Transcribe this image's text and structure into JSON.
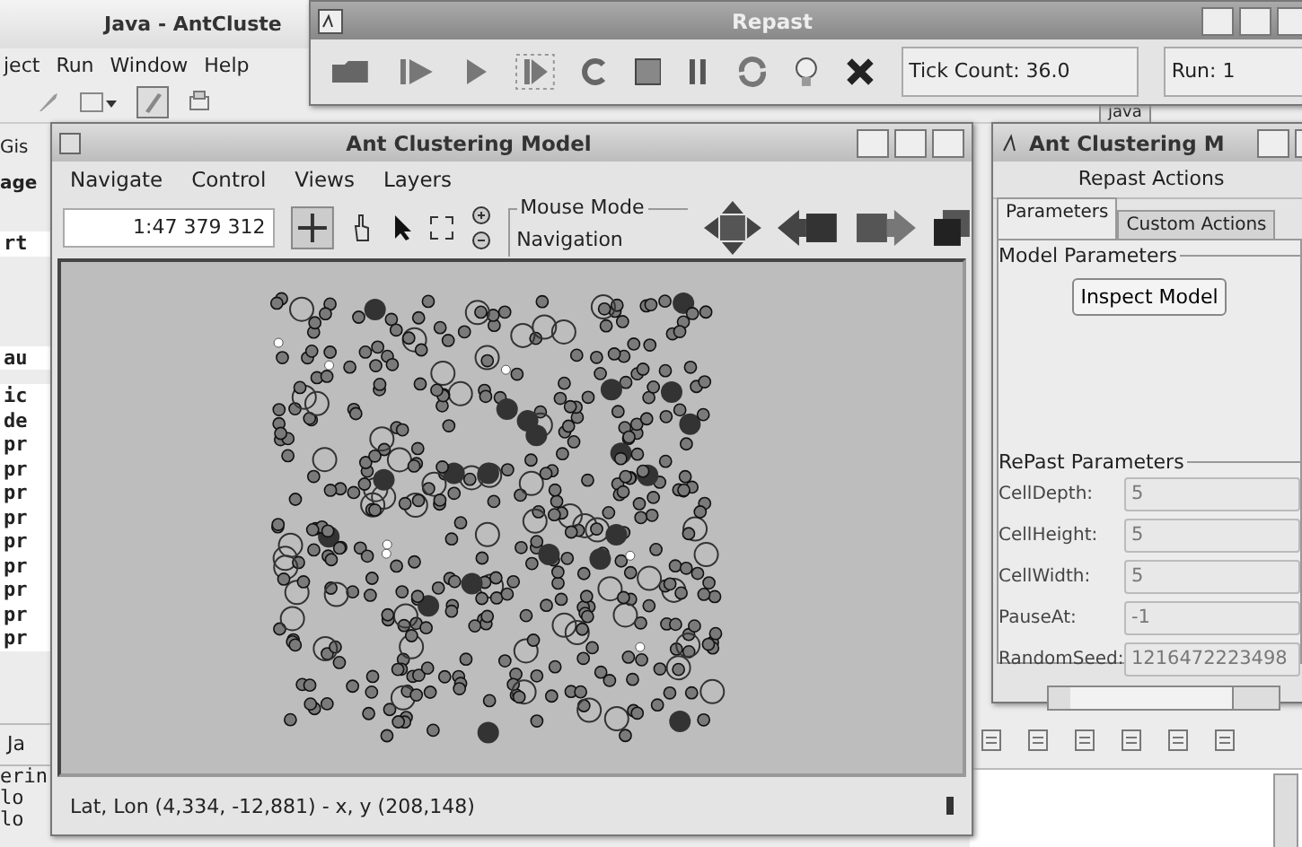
{
  "ide_window": {
    "title": "Java - AntCluste",
    "menu": [
      "ject",
      "Run",
      "Window",
      "Help"
    ],
    "side_labels": [
      "Gis",
      "age"
    ],
    "editor_groups": [
      [
        "rt"
      ],
      [
        "au"
      ],
      [
        "ic",
        "de",
        "pr",
        "pr",
        "pr",
        "pr",
        "pr",
        "pr",
        "pr",
        "pr",
        "pr"
      ]
    ],
    "bottom_tab": "Ja",
    "bottom_lines": [
      "erin",
      "lo",
      "lo"
    ],
    "perspective_tab": "java"
  },
  "repast_window": {
    "title": "Repast",
    "tick_count": "Tick Count: 36.0",
    "run": "Run: 1"
  },
  "model_window": {
    "title": "Ant Clustering Model",
    "menu": [
      "Navigate",
      "Control",
      "Views",
      "Layers"
    ],
    "scale": "1:47 379 312",
    "mouse_mode": {
      "legend": "Mouse Mode",
      "value": "Navigation"
    },
    "status": "Lat, Lon (4,334, -12,881) - x, y (208,148)"
  },
  "actions_window": {
    "title": "Ant Clustering M",
    "header": "Repast Actions",
    "tabs": [
      {
        "label": "Parameters",
        "selected": true
      },
      {
        "label": "Custom Actions",
        "selected": false
      }
    ],
    "model_parameters": {
      "legend": "Model Parameters",
      "button": "Inspect Model"
    },
    "repast_parameters": {
      "legend": "RePast Parameters",
      "fields": [
        {
          "label": "CellDepth:",
          "value": "5"
        },
        {
          "label": "CellHeight:",
          "value": "5"
        },
        {
          "label": "CellWidth:",
          "value": "5"
        },
        {
          "label": "PauseAt:",
          "value": "-1"
        },
        {
          "label": "RandomSeed:",
          "value": "1216472223498"
        }
      ]
    }
  }
}
